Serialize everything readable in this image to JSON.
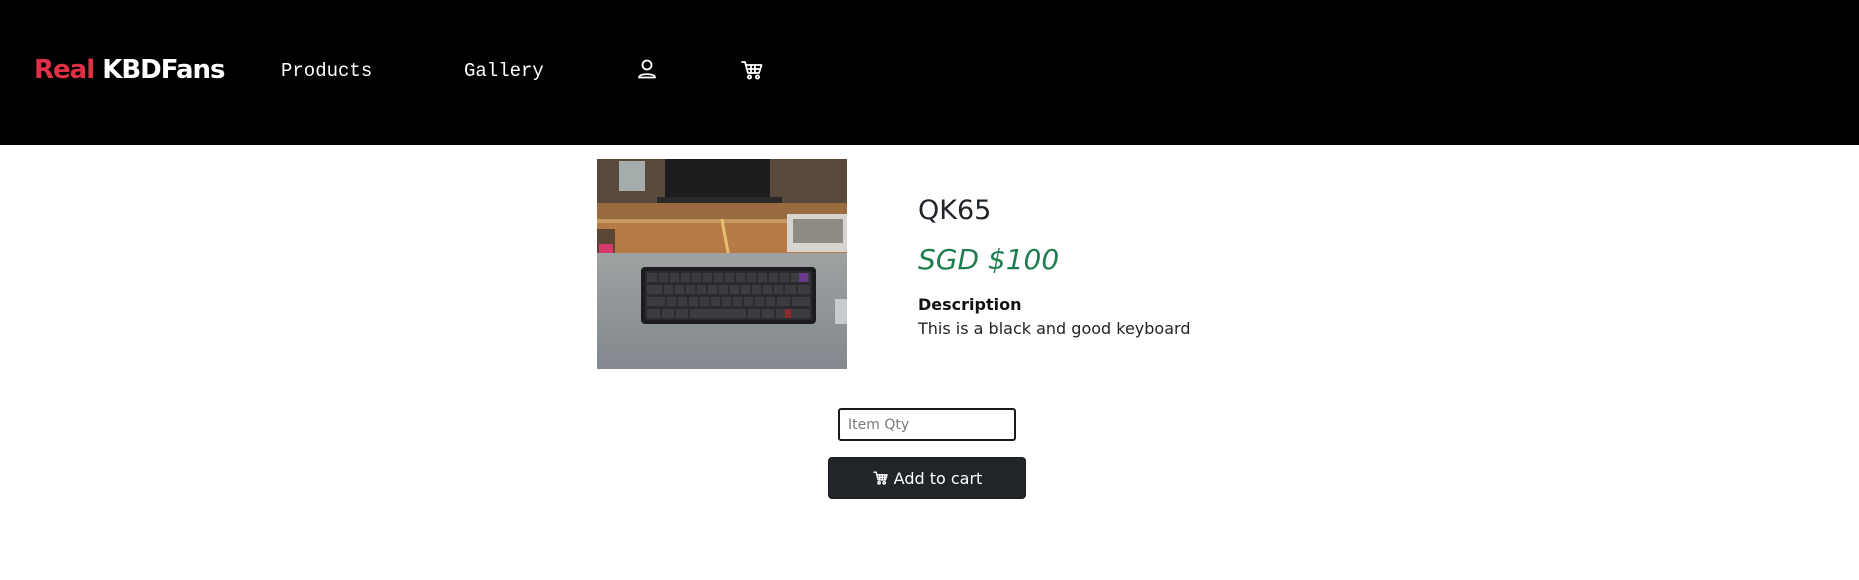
{
  "navbar": {
    "brand_part1": "Real",
    "brand_part2": "KBDFans",
    "links": [
      {
        "label": "Products"
      },
      {
        "label": "Gallery"
      }
    ],
    "icons": [
      "user-icon",
      "cart-icon"
    ]
  },
  "product": {
    "name": "QK65",
    "price": "SGD $100",
    "description_label": "Description",
    "description": "This is a black and good keyboard",
    "image_icon": "keyboard-photo"
  },
  "cart_form": {
    "qty_placeholder": "Item Qty",
    "qty_value": "",
    "add_button_label": "Add to cart",
    "add_button_icon": "cart-icon"
  },
  "colors": {
    "navbar_bg": "#000000",
    "brand_accent": "#e03046",
    "price": "#1e7e4e",
    "button_bg": "#212529"
  }
}
